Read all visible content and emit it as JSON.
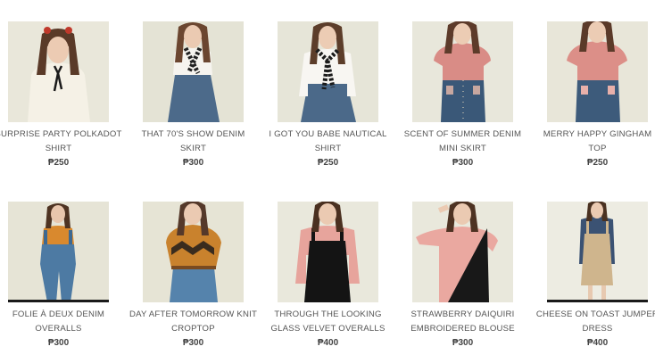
{
  "products": [
    {
      "title": "SURPRISE PARTY POLKADOT SHIRT",
      "price": "₱250",
      "top": "#f5f1e6",
      "bottom": "#3e5c7a",
      "accent": "#1a1a1a",
      "hair": "#5a3a28"
    },
    {
      "title": "THAT 70'S SHOW DENIM SKIRT",
      "price": "₱300",
      "top": "#f6f4ef",
      "bottom": "#4c6a8a",
      "accent": "#222222",
      "hair": "#6b4630"
    },
    {
      "title": "I GOT YOU BABE NAUTICAL SHIRT",
      "price": "₱250",
      "top": "#f8f6f2",
      "bottom": "#4b6989",
      "accent": "#1b1b1b",
      "hair": "#5c3d2a"
    },
    {
      "title": "SCENT OF SUMMER DENIM MINI SKIRT",
      "price": "₱300",
      "top": "#d98c86",
      "bottom": "#3a5878",
      "accent": "#c7a7a0",
      "hair": "#5d3b2a"
    },
    {
      "title": "MERRY HAPPY GINGHAM TOP",
      "price": "₱250",
      "top": "#dc8f88",
      "bottom": "#3d5b7b",
      "accent": "#e8b0aa",
      "hair": "#5b3a29"
    },
    {
      "title": "FOLIE À DEUX DENIM OVERALLS",
      "price": "₱300",
      "top": "#d9892e",
      "bottom": "#4d7aa3",
      "accent": "#4d7aa3",
      "hair": "#4e3322"
    },
    {
      "title": "DAY AFTER TOMORROW KNIT CROPTOP",
      "price": "₱300",
      "top": "#c9822d",
      "bottom": "#5583ac",
      "accent": "#3a2c1e",
      "hair": "#55392a"
    },
    {
      "title": "THROUGH THE LOOKING GLASS VELVET OVERALLS",
      "price": "₱400",
      "top": "#e7a49c",
      "bottom": "#141414",
      "accent": "#141414",
      "hair": "#4a3020"
    },
    {
      "title": "STRAWBERRY DAIQUIRI EMBROIDERED BLOUSE",
      "price": "₱300",
      "top": "#eaa8a0",
      "bottom": "#181818",
      "accent": "#181818",
      "hair": "#4d3222"
    },
    {
      "title": "CHEESE ON TOAST JUMPER DRESS",
      "price": "₱400",
      "top": "#3b5273",
      "bottom": "#cfb58d",
      "accent": "#cfb58d",
      "hair": "#4a3121"
    }
  ]
}
